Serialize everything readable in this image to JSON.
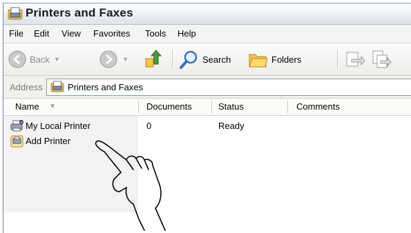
{
  "window": {
    "title": "Printers and Faxes"
  },
  "menu": [
    "File",
    "Edit",
    "View",
    "Favorites",
    "Tools",
    "Help"
  ],
  "toolbar": {
    "back_label": "Back",
    "search_label": "Search",
    "folders_label": "Folders"
  },
  "address": {
    "label": "Address",
    "value": "Printers and Faxes"
  },
  "columns": [
    "Name",
    "Documents",
    "Status",
    "Comments"
  ],
  "rows": [
    {
      "name": "My Local Printer",
      "documents": "0",
      "status": "Ready",
      "comments": ""
    },
    {
      "name": "Add Printer",
      "documents": "",
      "status": "",
      "comments": ""
    }
  ],
  "icons": {
    "app": "printers-folder-icon",
    "back": "back-arrow-icon",
    "forward": "forward-arrow-icon",
    "up": "up-folder-icon",
    "search": "search-magnifier-icon",
    "folders": "folders-icon",
    "move_to": "move-to-icon",
    "copy_to": "copy-to-icon",
    "sort": "sort-chevron-icon",
    "printer": "printer-icon",
    "add_printer": "add-printer-icon",
    "pointer": "pointing-hand-icon"
  },
  "colors": {
    "address_border": "#7f9db9",
    "nav_green": "#4a9a3a",
    "folder_yellow": "#f4c54a"
  }
}
